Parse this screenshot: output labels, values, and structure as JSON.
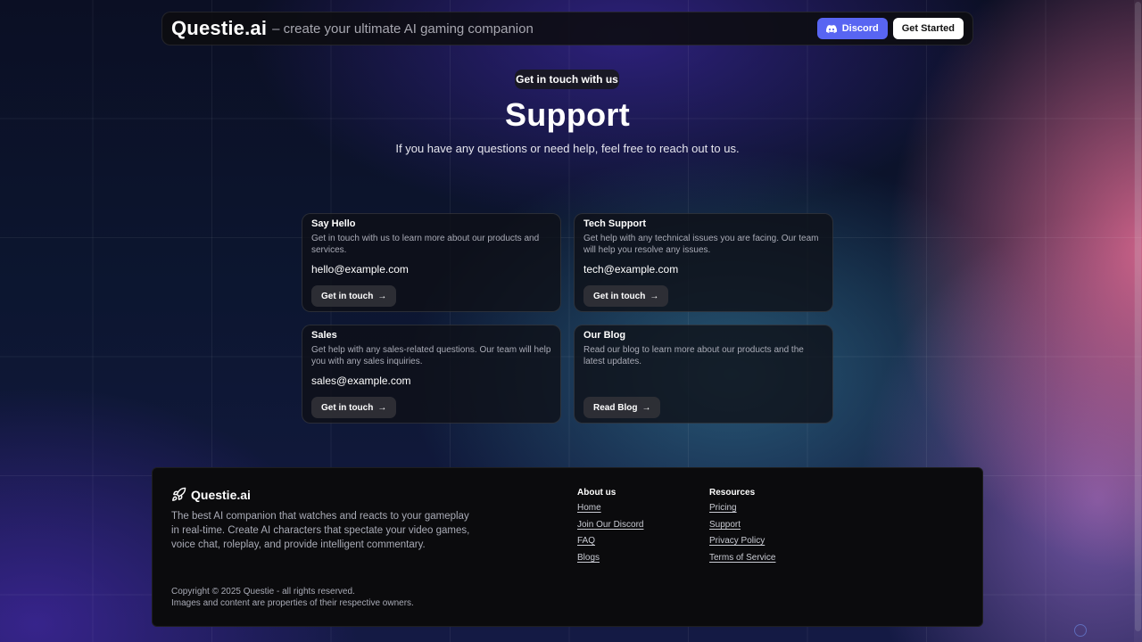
{
  "nav": {
    "brand": "Questie.ai",
    "tagline": "– create your ultimate AI gaming companion",
    "discord_label": "Discord",
    "get_started_label": "Get Started"
  },
  "hero": {
    "pill": "Get in touch with us",
    "title": "Support",
    "subtitle": "If you have any questions or need help, feel free to reach out to us."
  },
  "cards": [
    {
      "title": "Say Hello",
      "desc": "Get in touch with us to learn more about our products and services.",
      "email": "hello@example.com",
      "button": "Get in touch"
    },
    {
      "title": "Tech Support",
      "desc": "Get help with any technical issues you are facing. Our team will help you resolve any issues.",
      "email": "tech@example.com",
      "button": "Get in touch"
    },
    {
      "title": "Sales",
      "desc": "Get help with any sales-related questions. Our team will help you with any sales inquiries.",
      "email": "sales@example.com",
      "button": "Get in touch"
    },
    {
      "title": "Our Blog",
      "desc": "Read our blog to learn more about our products and the latest updates.",
      "email": "",
      "button": "Read Blog"
    }
  ],
  "footer": {
    "brand": "Questie.ai",
    "description": "The best AI companion that watches and reacts to your gameplay in real-time. Create AI characters that spectate your video games, voice chat, roleplay, and provide intelligent commentary.",
    "about": {
      "heading": "About us",
      "links": [
        "Home",
        "Join Our Discord",
        "FAQ",
        "Blogs"
      ]
    },
    "resources": {
      "heading": "Resources",
      "links": [
        "Pricing",
        "Support",
        "Privacy Policy",
        "Terms of Service"
      ]
    },
    "copyright": "Copyright © 2025 Questie - all rights reserved.",
    "notice": "Images and content are properties of their respective owners."
  },
  "colors": {
    "discord": "#5865f2",
    "card_bg": "#0e1016",
    "footer_bg": "#0b0b0d",
    "muted_text": "#a9abb6"
  },
  "icons": [
    "discord-icon",
    "arrow-right-icon",
    "rocket-icon"
  ]
}
